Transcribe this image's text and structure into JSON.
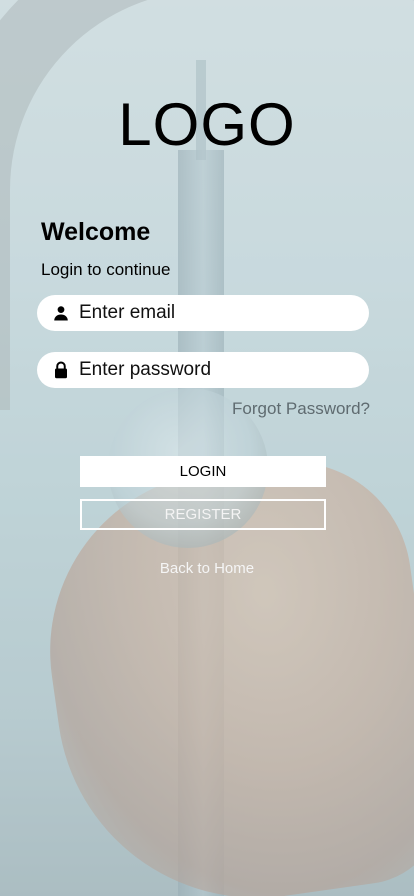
{
  "brand": {
    "logo_text": "LOGO"
  },
  "form": {
    "heading": "Welcome",
    "subheading": "Login to continue",
    "email": {
      "placeholder": "Enter email",
      "icon": "user-icon"
    },
    "password": {
      "placeholder": "Enter password",
      "icon": "lock-icon"
    },
    "forgot_label": "Forgot Password?"
  },
  "actions": {
    "login_label": "LOGIN",
    "register_label": "REGISTER",
    "back_label": "Back to Home"
  },
  "colors": {
    "forgot_text": "#5f6b70",
    "button_bg": "#ffffff",
    "field_bg": "#ffffff"
  }
}
